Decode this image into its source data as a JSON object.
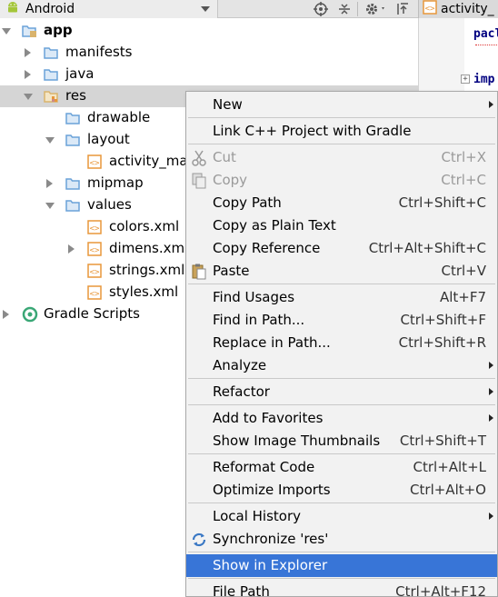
{
  "toolbar": {
    "view_label": "Android",
    "icons": [
      "android-icon",
      "chevron-down-icon",
      "crosshair-icon",
      "collapse-icon",
      "gear-icon",
      "hide-icon"
    ]
  },
  "editor": {
    "tab_label": "activity_",
    "code_lines": [
      "pacl",
      "imp"
    ]
  },
  "tree": {
    "items": [
      {
        "label": "app",
        "icon": "module-folder-icon"
      },
      {
        "label": "manifests",
        "icon": "folder-icon"
      },
      {
        "label": "java",
        "icon": "folder-icon"
      },
      {
        "label": "res",
        "icon": "res-folder-icon"
      },
      {
        "label": "drawable",
        "icon": "folder-icon"
      },
      {
        "label": "layout",
        "icon": "folder-icon"
      },
      {
        "label": "activity_ma",
        "icon": "xml-file-icon"
      },
      {
        "label": "mipmap",
        "icon": "folder-icon"
      },
      {
        "label": "values",
        "icon": "folder-icon"
      },
      {
        "label": "colors.xml",
        "icon": "xml-file-icon"
      },
      {
        "label": "dimens.xml",
        "icon": "xml-file-icon"
      },
      {
        "label": "strings.xml",
        "icon": "xml-file-icon"
      },
      {
        "label": "styles.xml",
        "icon": "xml-file-icon"
      },
      {
        "label": "Gradle Scripts",
        "icon": "gradle-icon"
      }
    ]
  },
  "menu": {
    "items": [
      {
        "label": "New",
        "shortcut": ""
      },
      {
        "label": "Link C++ Project with Gradle",
        "shortcut": ""
      },
      {
        "label": "Cut",
        "shortcut": "Ctrl+X"
      },
      {
        "label": "Copy",
        "shortcut": "Ctrl+C"
      },
      {
        "label": "Copy Path",
        "shortcut": "Ctrl+Shift+C"
      },
      {
        "label": "Copy as Plain Text",
        "shortcut": ""
      },
      {
        "label": "Copy Reference",
        "shortcut": "Ctrl+Alt+Shift+C"
      },
      {
        "label": "Paste",
        "shortcut": "Ctrl+V"
      },
      {
        "label": "Find Usages",
        "shortcut": "Alt+F7"
      },
      {
        "label": "Find in Path...",
        "shortcut": "Ctrl+Shift+F"
      },
      {
        "label": "Replace in Path...",
        "shortcut": "Ctrl+Shift+R"
      },
      {
        "label": "Analyze",
        "shortcut": ""
      },
      {
        "label": "Refactor",
        "shortcut": ""
      },
      {
        "label": "Add to Favorites",
        "shortcut": ""
      },
      {
        "label": "Show Image Thumbnails",
        "shortcut": "Ctrl+Shift+T"
      },
      {
        "label": "Reformat Code",
        "shortcut": "Ctrl+Alt+L"
      },
      {
        "label": "Optimize Imports",
        "shortcut": "Ctrl+Alt+O"
      },
      {
        "label": "Local History",
        "shortcut": ""
      },
      {
        "label": "Synchronize 'res'",
        "shortcut": ""
      },
      {
        "label": "Show in Explorer",
        "shortcut": ""
      },
      {
        "label": "File Path",
        "shortcut": "Ctrl+Alt+F12"
      }
    ]
  },
  "colors": {
    "highlight": "#3875d7",
    "folder_blue": "#6aa2d8",
    "folder_tan": "#d9b36c",
    "xml_orange": "#e8973a",
    "android_green": "#a4c639",
    "gradle_green": "#3aa776"
  }
}
